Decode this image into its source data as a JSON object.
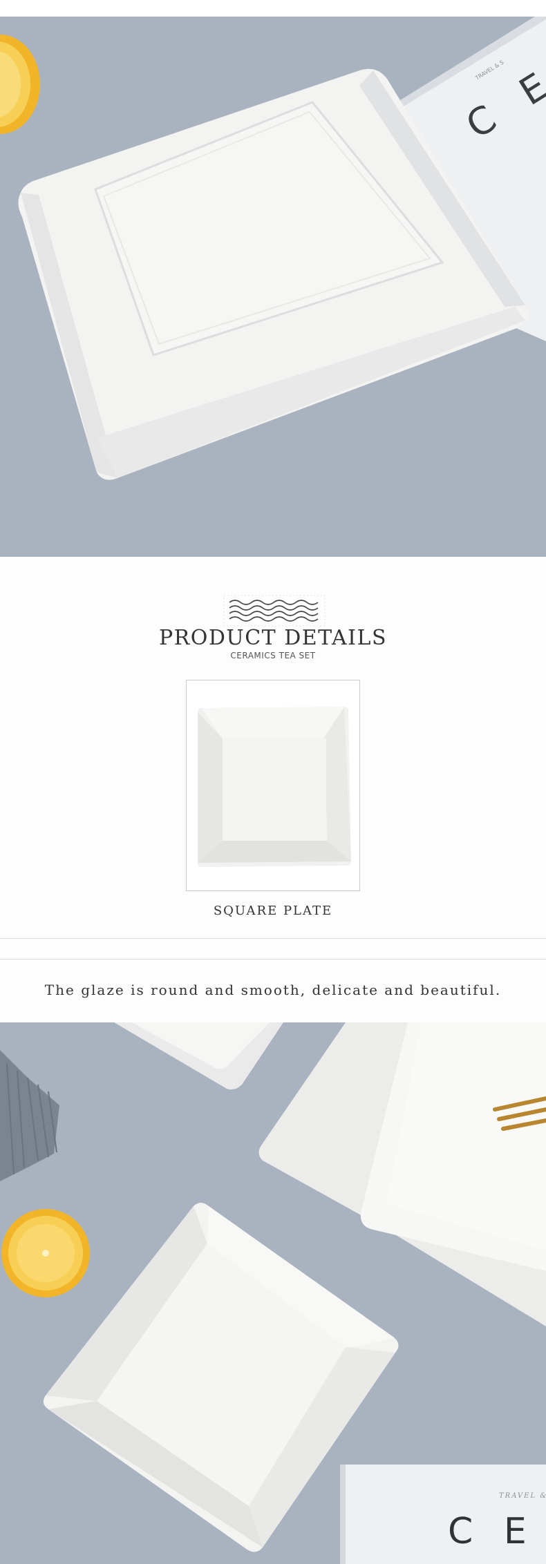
{
  "details": {
    "title": "PRODUCT DETAILS",
    "subtitle": "CERAMICS TEA SET",
    "caption": "SQUARE PLATE"
  },
  "glaze": {
    "text": "The glaze is round and smooth, delicate and beautiful."
  },
  "photo1": {
    "book_text": "C E R",
    "book_small": "TRAVEL & S"
  },
  "photo2": {
    "book_text": "C E R",
    "book_small": "TRAVEL &"
  },
  "colors": {
    "table": "#a9b3bf",
    "plate": "#f4f4f2",
    "lemon": "#f2b52a",
    "fork": "#b8862e"
  }
}
